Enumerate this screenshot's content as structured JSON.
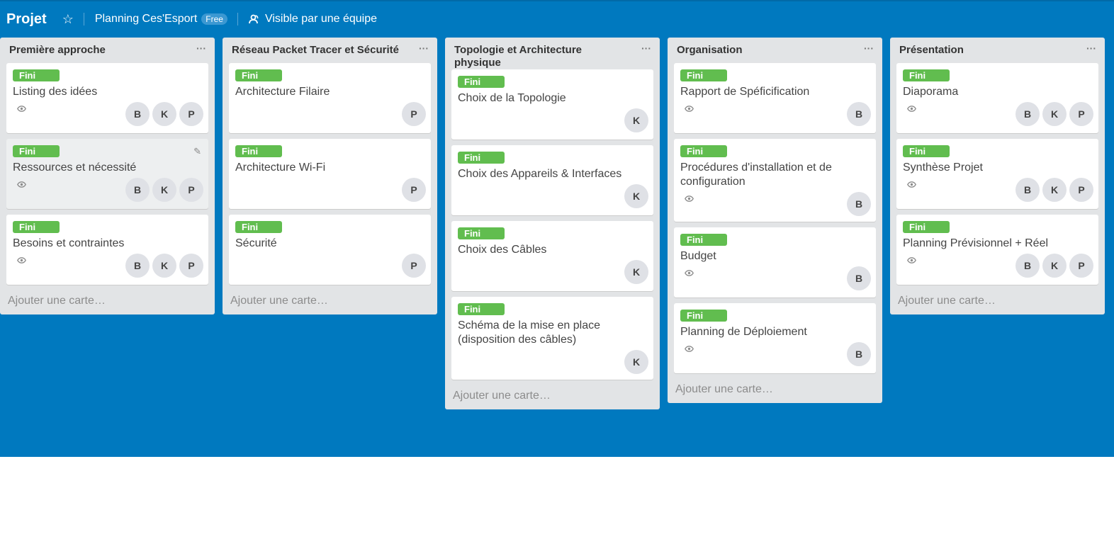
{
  "header": {
    "title": "Projet",
    "team": "Planning Ces'Esport",
    "badge": "Free",
    "visibility": "Visible par une équipe"
  },
  "add_card_label": "Ajouter une carte…",
  "lists": [
    {
      "title": "Première approche",
      "cards": [
        {
          "label": "Fini",
          "title": "Listing des idées",
          "watch": true,
          "members": [
            "B",
            "K",
            "P"
          ]
        },
        {
          "label": "Fini",
          "title": "Ressources et nécessité",
          "watch": true,
          "members": [
            "B",
            "K",
            "P"
          ]
        },
        {
          "label": "Fini",
          "title": "Besoins et contraintes",
          "watch": true,
          "members": [
            "B",
            "K",
            "P"
          ]
        }
      ]
    },
    {
      "title": "Réseau Packet Tracer et Sécurité",
      "cards": [
        {
          "label": "Fini",
          "title": "Architecture Filaire",
          "watch": false,
          "members": [
            "P"
          ]
        },
        {
          "label": "Fini",
          "title": "Architecture Wi-Fi",
          "watch": false,
          "members": [
            "P"
          ]
        },
        {
          "label": "Fini",
          "title": "Sécurité",
          "watch": false,
          "members": [
            "P"
          ]
        }
      ]
    },
    {
      "title": "Topologie et Architecture physique",
      "cards": [
        {
          "label": "Fini",
          "title": "Choix de la Topologie",
          "watch": false,
          "members": [
            "K"
          ]
        },
        {
          "label": "Fini",
          "title": "Choix des Appareils & Interfaces",
          "watch": false,
          "members": [
            "K"
          ]
        },
        {
          "label": "Fini",
          "title": "Choix des Câbles",
          "watch": false,
          "members": [
            "K"
          ]
        },
        {
          "label": "Fini",
          "title": "Schéma de la mise en place (disposition des câbles)",
          "watch": false,
          "members": [
            "K"
          ]
        }
      ]
    },
    {
      "title": "Organisation",
      "cards": [
        {
          "label": "Fini",
          "title": "Rapport de Spéficification",
          "watch": true,
          "members": [
            "B"
          ]
        },
        {
          "label": "Fini",
          "title": "Procédures d'installation et de configuration",
          "watch": true,
          "members": [
            "B"
          ]
        },
        {
          "label": "Fini",
          "title": "Budget",
          "watch": true,
          "members": [
            "B"
          ]
        },
        {
          "label": "Fini",
          "title": "Planning de Déploiement",
          "watch": true,
          "members": [
            "B"
          ]
        }
      ]
    },
    {
      "title": "Présentation",
      "cards": [
        {
          "label": "Fini",
          "title": "Diaporama",
          "watch": true,
          "members": [
            "B",
            "K",
            "P"
          ]
        },
        {
          "label": "Fini",
          "title": "Synthèse Projet",
          "watch": true,
          "members": [
            "B",
            "K",
            "P"
          ]
        },
        {
          "label": "Fini",
          "title": "Planning Prévisionnel + Réel",
          "watch": true,
          "members": [
            "B",
            "K",
            "P"
          ]
        }
      ]
    }
  ],
  "icons": {
    "star": "star-icon",
    "visibility": "team-visibility-icon",
    "watch": "eye-icon",
    "list_menu": "more-icon",
    "edit": "pencil-icon"
  },
  "colors": {
    "board_background": "#0079bf",
    "label_green": "#61bd4f",
    "list_background": "#e2e4e6"
  }
}
